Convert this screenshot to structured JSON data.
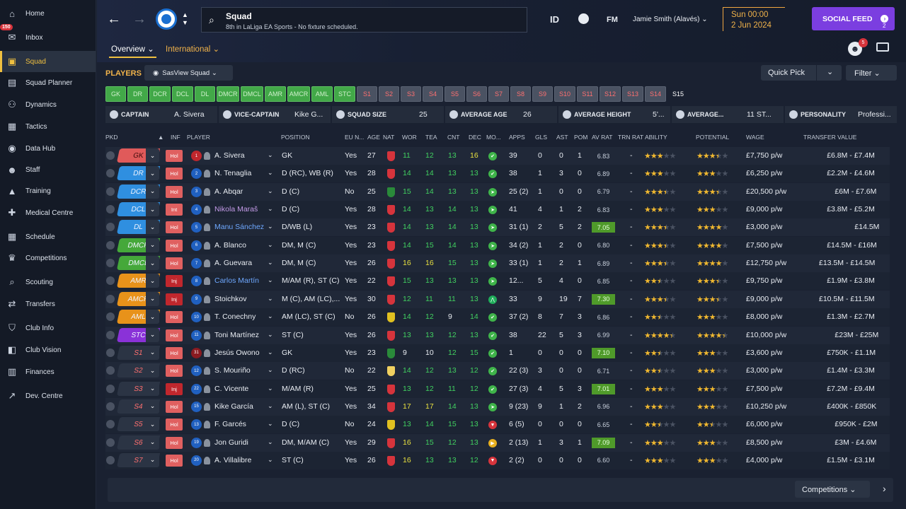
{
  "sidebar": {
    "items": [
      {
        "label": "Home",
        "icon": "home-icon",
        "glyph": "⌂"
      },
      {
        "label": "Inbox",
        "icon": "inbox-icon",
        "glyph": "✉",
        "badge": "150"
      },
      {
        "label": "Squad",
        "icon": "shirt-icon",
        "glyph": "▣",
        "active": true
      },
      {
        "label": "Squad Planner",
        "icon": "planner-icon",
        "glyph": "▤"
      },
      {
        "label": "Dynamics",
        "icon": "dynamics-icon",
        "glyph": "⚇"
      },
      {
        "label": "Tactics",
        "icon": "tactics-icon",
        "glyph": "▦"
      },
      {
        "label": "Data Hub",
        "icon": "data-hub-icon",
        "glyph": "◉"
      },
      {
        "label": "Staff",
        "icon": "staff-icon",
        "glyph": "☻"
      },
      {
        "label": "Training",
        "icon": "training-icon",
        "glyph": "▲"
      },
      {
        "label": "Medical Centre",
        "icon": "medical-icon",
        "glyph": "✚"
      },
      {
        "label": "Schedule",
        "icon": "schedule-icon",
        "glyph": "▦"
      },
      {
        "label": "Competitions",
        "icon": "trophy-icon",
        "glyph": "♛"
      },
      {
        "label": "Scouting",
        "icon": "scouting-icon",
        "glyph": "⌕"
      },
      {
        "label": "Transfers",
        "icon": "transfers-icon",
        "glyph": "⇄"
      },
      {
        "label": "Club Info",
        "icon": "shield-icon",
        "glyph": "⛉"
      },
      {
        "label": "Club Vision",
        "icon": "vision-icon",
        "glyph": "◧"
      },
      {
        "label": "Finances",
        "icon": "finances-icon",
        "glyph": "▥"
      },
      {
        "label": "Dev. Centre",
        "icon": "dev-centre-icon",
        "glyph": "↗"
      }
    ]
  },
  "header": {
    "title": "Squad",
    "subtitle": "8th in LaLiga EA Sports - No fixture scheduled.",
    "tab_overview": "Overview ⌄",
    "tab_international": "International ⌄",
    "id_label": "ID",
    "fm_label": "FM",
    "user": "Jamie Smith (Alavés)  ⌄",
    "date_line1": "Sun 00:00",
    "date_line2": "2 Jun 2024",
    "social_feed": "SOCIAL FEED",
    "social_count": "2",
    "notif_count": "5"
  },
  "toolbar": {
    "players_label": "PLAYERS",
    "view_label": "SasView Squad  ⌄",
    "quick_pick": "Quick Pick",
    "filter": "Filter  ⌄"
  },
  "positions": [
    {
      "label": "GK",
      "on": true
    },
    {
      "label": "DR",
      "on": true
    },
    {
      "label": "DCR",
      "on": true
    },
    {
      "label": "DCL",
      "on": true
    },
    {
      "label": "DL",
      "on": true
    },
    {
      "label": "DMCR",
      "on": true
    },
    {
      "label": "DMCL",
      "on": true
    },
    {
      "label": "AMR",
      "on": true
    },
    {
      "label": "AMCR",
      "on": true
    },
    {
      "label": "AML",
      "on": true
    },
    {
      "label": "STC",
      "on": true
    },
    {
      "label": "S1",
      "on": false
    },
    {
      "label": "S2",
      "on": false
    },
    {
      "label": "S3",
      "on": false
    },
    {
      "label": "S4",
      "on": false
    },
    {
      "label": "S5",
      "on": false
    },
    {
      "label": "S6",
      "on": false
    },
    {
      "label": "S7",
      "on": false
    },
    {
      "label": "S8",
      "on": false
    },
    {
      "label": "S9",
      "on": false
    },
    {
      "label": "S10",
      "on": false
    },
    {
      "label": "S11",
      "on": false
    },
    {
      "label": "S12",
      "on": false
    },
    {
      "label": "S13",
      "on": false
    },
    {
      "label": "S14",
      "on": false
    },
    {
      "label": "S15",
      "on": null
    }
  ],
  "info": {
    "captain_label": "CAPTAIN",
    "captain": "A. Sivera",
    "vice_label": "VICE-CAPTAIN",
    "vice": "Kike G...",
    "size_label": "SQUAD SIZE",
    "size": "25",
    "age_label": "AVERAGE AGE",
    "age": "26",
    "height_label": "AVERAGE HEIGHT",
    "height": "5'...",
    "avg_label": "AVERAGE...",
    "avg": "11 ST...",
    "personality_label": "PERSONALITY",
    "personality": "Professi..."
  },
  "columns": {
    "pkd": "PKD",
    "inf": "INF",
    "player": "PLAYER",
    "position": "POSITION",
    "eu": "EU N...",
    "age": "AGE",
    "nat": "NAT",
    "wor": "WOR",
    "tea": "TEA",
    "cnt": "CNT",
    "dec": "DEC",
    "mo": "MO...",
    "apps": "APPS",
    "gls": "GLS",
    "ast": "AST",
    "pom": "POM",
    "avrat": "AV RAT",
    "trnrat": "TRN RAT",
    "ability": "ABILITY",
    "potential": "POTENTIAL",
    "wage": "WAGE",
    "value": "TRANSFER VALUE"
  },
  "colors": {
    "gk": "#e05a5a",
    "def": "#2f8fe0",
    "dm": "#45a83a",
    "am": "#e8921a",
    "st": "#8a32d8",
    "sub": "#2b3444",
    "accent": "#f0b24a"
  },
  "players": [
    {
      "pkd": "GK",
      "pkdc": "gk",
      "inf": "Hol",
      "num": "1",
      "numc": "#c0272d",
      "name": "A. Sivera",
      "pos": "GK",
      "eu": "Yes",
      "age": "27",
      "natc": "#d6343c",
      "wor": "11",
      "worc": "g",
      "tea": "12",
      "teac": "g",
      "cnt": "13",
      "cntc": "g",
      "dec": "16",
      "decc": "y",
      "mo": "✔",
      "moc": "#3fb44a",
      "apps": "39",
      "gls": "0",
      "ast": "0",
      "pom": "1",
      "avrat": "6.83",
      "hi": false,
      "trn": "-",
      "ab": 3,
      "po": 3.5,
      "wage": "£7,750 p/w",
      "value": "£6.8M - £7.4M"
    },
    {
      "pkd": "DR",
      "pkdc": "def",
      "inf": "Hol",
      "num": "2",
      "numc": "#2060c0",
      "name": "N. Tenaglia",
      "pos": "D (RC), WB (R)",
      "eu": "Yes",
      "age": "28",
      "natc": "#d6343c",
      "wor": "14",
      "worc": "g",
      "tea": "14",
      "teac": "g",
      "cnt": "13",
      "cntc": "g",
      "dec": "13",
      "decc": "g",
      "mo": "✔",
      "moc": "#3fb44a",
      "apps": "38",
      "gls": "1",
      "ast": "3",
      "pom": "0",
      "avrat": "6.89",
      "hi": false,
      "trn": "-",
      "ab": 3,
      "po": 3,
      "wage": "£6,250 p/w",
      "value": "£2.2M - £4.6M"
    },
    {
      "pkd": "DCR",
      "pkdc": "def",
      "inf": "Hol",
      "num": "3",
      "numc": "#2060c0",
      "name": "A. Abqar",
      "pos": "D (C)",
      "eu": "No",
      "age": "25",
      "natc": "#2a8a3a",
      "wor": "15",
      "worc": "g",
      "tea": "14",
      "teac": "g",
      "cnt": "13",
      "cntc": "g",
      "dec": "13",
      "decc": "g",
      "mo": "➤",
      "moc": "#3fb44a",
      "apps": "25 (2)",
      "gls": "1",
      "ast": "0",
      "pom": "0",
      "avrat": "6.79",
      "hi": false,
      "trn": "-",
      "ab": 3.5,
      "po": 3.5,
      "wage": "£20,500 p/w",
      "value": "£6M - £7.6M"
    },
    {
      "pkd": "DCL",
      "pkdc": "def",
      "inf": "Int",
      "num": "4",
      "numc": "#2060c0",
      "name": "Nikola Maraš",
      "pos": "D (C)",
      "eu": "Yes",
      "age": "28",
      "natc": "#d6343c",
      "wor": "14",
      "worc": "g",
      "tea": "13",
      "teac": "g",
      "cnt": "14",
      "cntc": "g",
      "dec": "13",
      "decc": "g",
      "mo": "➤",
      "moc": "#3fb44a",
      "apps": "41",
      "gls": "4",
      "ast": "1",
      "pom": "2",
      "avrat": "6.83",
      "hi": false,
      "trn": "-",
      "ab": 3,
      "po": 3,
      "wage": "£9,000 p/w",
      "value": "£3.8M - £5.2M",
      "purple": true
    },
    {
      "pkd": "DL",
      "pkdc": "def",
      "inf": "Hol",
      "num": "5",
      "numc": "#2060c0",
      "name": "Manu Sánchez",
      "pos": "D/WB (L)",
      "eu": "Yes",
      "age": "23",
      "natc": "#d6343c",
      "wor": "14",
      "worc": "g",
      "tea": "13",
      "teac": "g",
      "cnt": "14",
      "cntc": "g",
      "dec": "13",
      "decc": "g",
      "mo": "➤",
      "moc": "#3fb44a",
      "apps": "31 (1)",
      "gls": "2",
      "ast": "5",
      "pom": "2",
      "avrat": "7.05",
      "hi": true,
      "trn": "-",
      "ab": 3.5,
      "po": 4,
      "wage": "£3,000 p/w",
      "value": "£14.5M",
      "link": true
    },
    {
      "pkd": "DMCR",
      "pkdc": "dm",
      "inf": "Hol",
      "num": "6",
      "numc": "#2060c0",
      "name": "A. Blanco",
      "pos": "DM, M (C)",
      "eu": "Yes",
      "age": "23",
      "natc": "#d6343c",
      "wor": "14",
      "worc": "g",
      "tea": "15",
      "teac": "g",
      "cnt": "14",
      "cntc": "g",
      "dec": "13",
      "decc": "g",
      "mo": "➤",
      "moc": "#3fb44a",
      "apps": "34 (2)",
      "gls": "1",
      "ast": "2",
      "pom": "0",
      "avrat": "6.80",
      "hi": false,
      "trn": "-",
      "ab": 3.5,
      "po": 4,
      "wage": "£7,500 p/w",
      "value": "£14.5M - £16M"
    },
    {
      "pkd": "DMCL",
      "pkdc": "dm",
      "inf": "Hol",
      "num": "7",
      "numc": "#2060c0",
      "name": "A. Guevara",
      "pos": "DM, M (C)",
      "eu": "Yes",
      "age": "26",
      "natc": "#d6343c",
      "wor": "16",
      "worc": "y",
      "tea": "16",
      "teac": "y",
      "cnt": "15",
      "cntc": "g",
      "dec": "13",
      "decc": "g",
      "mo": "➤",
      "moc": "#3fb44a",
      "apps": "33 (1)",
      "gls": "1",
      "ast": "2",
      "pom": "1",
      "avrat": "6.89",
      "hi": false,
      "trn": "-",
      "ab": 3.5,
      "po": 4,
      "wage": "£12,750 p/w",
      "value": "£13.5M - £14.5M"
    },
    {
      "pkd": "AMR",
      "pkdc": "am",
      "inf": "Inj",
      "num": "8",
      "numc": "#2060c0",
      "name": "Carlos Martín",
      "pos": "M/AM (R), ST (C)",
      "eu": "Yes",
      "age": "22",
      "natc": "#d6343c",
      "wor": "15",
      "worc": "g",
      "tea": "13",
      "teac": "g",
      "cnt": "13",
      "cntc": "g",
      "dec": "13",
      "decc": "g",
      "mo": "➤",
      "moc": "#3fb44a",
      "apps": "12...",
      "gls": "5",
      "ast": "4",
      "pom": "0",
      "avrat": "6.85",
      "hi": false,
      "trn": "-",
      "ab": 2.5,
      "po": 3.5,
      "wage": "£9,750 p/w",
      "value": "£1.9M - £3.8M",
      "link": true
    },
    {
      "pkd": "AMCR",
      "pkdc": "am",
      "inf": "Inj",
      "num": "9",
      "numc": "#2060c0",
      "name": "Stoichkov",
      "pos": "M (C), AM (LC),...",
      "eu": "Yes",
      "age": "30",
      "natc": "#d6343c",
      "wor": "12",
      "worc": "g",
      "tea": "11",
      "teac": "g",
      "cnt": "11",
      "cntc": "g",
      "dec": "13",
      "decc": "g",
      "mo": "⋀",
      "moc": "#1fae5a",
      "apps": "33",
      "gls": "9",
      "ast": "19",
      "pom": "7",
      "avrat": "7.30",
      "hi": true,
      "trn": "-",
      "ab": 3.5,
      "po": 3.5,
      "wage": "£9,000 p/w",
      "value": "£10.5M - £11.5M"
    },
    {
      "pkd": "AML",
      "pkdc": "am",
      "inf": "Hol",
      "num": "10",
      "numc": "#2060c0",
      "name": "T. Conechny",
      "pos": "AM (LC), ST (C)",
      "eu": "No",
      "age": "26",
      "natc": "#e0c020",
      "wor": "14",
      "worc": "g",
      "tea": "12",
      "teac": "g",
      "cnt": "9",
      "cntc": "n",
      "dec": "14",
      "decc": "g",
      "mo": "✔",
      "moc": "#3fb44a",
      "apps": "37 (2)",
      "gls": "8",
      "ast": "7",
      "pom": "3",
      "avrat": "6.86",
      "hi": false,
      "trn": "-",
      "ab": 2.5,
      "po": 3,
      "wage": "£8,000 p/w",
      "value": "£1.3M - £2.7M"
    },
    {
      "pkd": "STC",
      "pkdc": "st",
      "inf": "Hol",
      "num": "11",
      "numc": "#2060c0",
      "name": "Toni Martínez",
      "pos": "ST (C)",
      "eu": "Yes",
      "age": "26",
      "natc": "#d6343c",
      "wor": "13",
      "worc": "g",
      "tea": "13",
      "teac": "g",
      "cnt": "12",
      "cntc": "g",
      "dec": "13",
      "decc": "g",
      "mo": "✔",
      "moc": "#3fb44a",
      "apps": "38",
      "gls": "22",
      "ast": "5",
      "pom": "3",
      "avrat": "6.99",
      "hi": false,
      "trn": "-",
      "ab": 4.5,
      "po": 4.5,
      "wage": "£10,000 p/w",
      "value": "£23M - £25M"
    },
    {
      "pkd": "S1",
      "pkdc": "sub",
      "inf": "Hol",
      "num": "31",
      "numc": "#8a1a20",
      "name": "Jesús Owono",
      "pos": "GK",
      "eu": "Yes",
      "age": "23",
      "natc": "#2a8a3a",
      "wor": "9",
      "worc": "n",
      "tea": "10",
      "teac": "n",
      "cnt": "12",
      "cntc": "g",
      "dec": "15",
      "decc": "g",
      "mo": "✔",
      "moc": "#3fb44a",
      "apps": "1",
      "gls": "0",
      "ast": "0",
      "pom": "0",
      "avrat": "7.10",
      "hi": true,
      "trn": "-",
      "ab": 2.5,
      "po": 3,
      "wage": "£3,600 p/w",
      "value": "£750K - £1.1M"
    },
    {
      "pkd": "S2",
      "pkdc": "sub",
      "inf": "Hol",
      "num": "12",
      "numc": "#2060c0",
      "name": "S. Mouriño",
      "pos": "D (RC)",
      "eu": "No",
      "age": "22",
      "natc": "#f0d060",
      "wor": "14",
      "worc": "g",
      "tea": "12",
      "teac": "g",
      "cnt": "13",
      "cntc": "g",
      "dec": "12",
      "decc": "g",
      "mo": "✔",
      "moc": "#3fb44a",
      "apps": "22 (3)",
      "gls": "3",
      "ast": "0",
      "pom": "0",
      "avrat": "6.71",
      "hi": false,
      "trn": "-",
      "ab": 2.5,
      "po": 3,
      "wage": "£3,000 p/w",
      "value": "£1.4M - £3.3M"
    },
    {
      "pkd": "S3",
      "pkdc": "sub",
      "inf": "Inj",
      "num": "22",
      "numc": "#2060c0",
      "name": "C. Vicente",
      "pos": "M/AM (R)",
      "eu": "Yes",
      "age": "25",
      "natc": "#d6343c",
      "wor": "13",
      "worc": "g",
      "tea": "12",
      "teac": "g",
      "cnt": "11",
      "cntc": "g",
      "dec": "12",
      "decc": "g",
      "mo": "✔",
      "moc": "#3fb44a",
      "apps": "27 (3)",
      "gls": "4",
      "ast": "5",
      "pom": "3",
      "avrat": "7.01",
      "hi": true,
      "trn": "-",
      "ab": 3,
      "po": 3,
      "wage": "£7,500 p/w",
      "value": "£7.2M - £9.4M"
    },
    {
      "pkd": "S4",
      "pkdc": "sub",
      "inf": "Hol",
      "num": "15",
      "numc": "#2060c0",
      "name": "Kike García",
      "pos": "AM (L), ST (C)",
      "eu": "Yes",
      "age": "34",
      "natc": "#d6343c",
      "wor": "17",
      "worc": "y",
      "tea": "17",
      "teac": "y",
      "cnt": "14",
      "cntc": "g",
      "dec": "13",
      "decc": "g",
      "mo": "➤",
      "moc": "#3fb44a",
      "apps": "9 (23)",
      "gls": "9",
      "ast": "1",
      "pom": "2",
      "avrat": "6.96",
      "hi": false,
      "trn": "-",
      "ab": 3,
      "po": 3,
      "wage": "£10,250 p/w",
      "value": "£400K - £850K"
    },
    {
      "pkd": "S5",
      "pkdc": "sub",
      "inf": "Hol",
      "num": "13",
      "numc": "#2060c0",
      "name": "F. Garcés",
      "pos": "D (C)",
      "eu": "No",
      "age": "24",
      "natc": "#e0c020",
      "wor": "13",
      "worc": "g",
      "tea": "14",
      "teac": "g",
      "cnt": "15",
      "cntc": "g",
      "dec": "13",
      "decc": "g",
      "mo": "▼",
      "moc": "#d6343c",
      "apps": "6 (5)",
      "gls": "0",
      "ast": "0",
      "pom": "0",
      "avrat": "6.65",
      "hi": false,
      "trn": "-",
      "ab": 2.5,
      "po": 2.5,
      "wage": "£6,000 p/w",
      "value": "£950K - £2M"
    },
    {
      "pkd": "S6",
      "pkdc": "sub",
      "inf": "Hol",
      "num": "19",
      "numc": "#2060c0",
      "name": "Jon Guridi",
      "pos": "DM, M/AM (C)",
      "eu": "Yes",
      "age": "29",
      "natc": "#d6343c",
      "wor": "16",
      "worc": "y",
      "tea": "15",
      "teac": "g",
      "cnt": "12",
      "cntc": "g",
      "dec": "13",
      "decc": "g",
      "mo": "▶",
      "moc": "#e8b020",
      "apps": "2 (13)",
      "gls": "1",
      "ast": "3",
      "pom": "1",
      "avrat": "7.09",
      "hi": true,
      "trn": "-",
      "ab": 3,
      "po": 3,
      "wage": "£8,500 p/w",
      "value": "£3M - £4.6M"
    },
    {
      "pkd": "S7",
      "pkdc": "sub",
      "inf": "Hol",
      "num": "20",
      "numc": "#2060c0",
      "name": "A. Villalibre",
      "pos": "ST (C)",
      "eu": "Yes",
      "age": "26",
      "natc": "#d6343c",
      "wor": "16",
      "worc": "y",
      "tea": "13",
      "teac": "g",
      "cnt": "13",
      "cntc": "g",
      "dec": "12",
      "decc": "g",
      "mo": "▼",
      "moc": "#d6343c",
      "apps": "2 (2)",
      "gls": "0",
      "ast": "0",
      "pom": "0",
      "avrat": "6.60",
      "hi": false,
      "trn": "-",
      "ab": 3,
      "po": 3,
      "wage": "£4,000 p/w",
      "value": "£1.5M - £3.1M"
    }
  ],
  "footer": {
    "competitions": "Competitions  ⌄"
  }
}
